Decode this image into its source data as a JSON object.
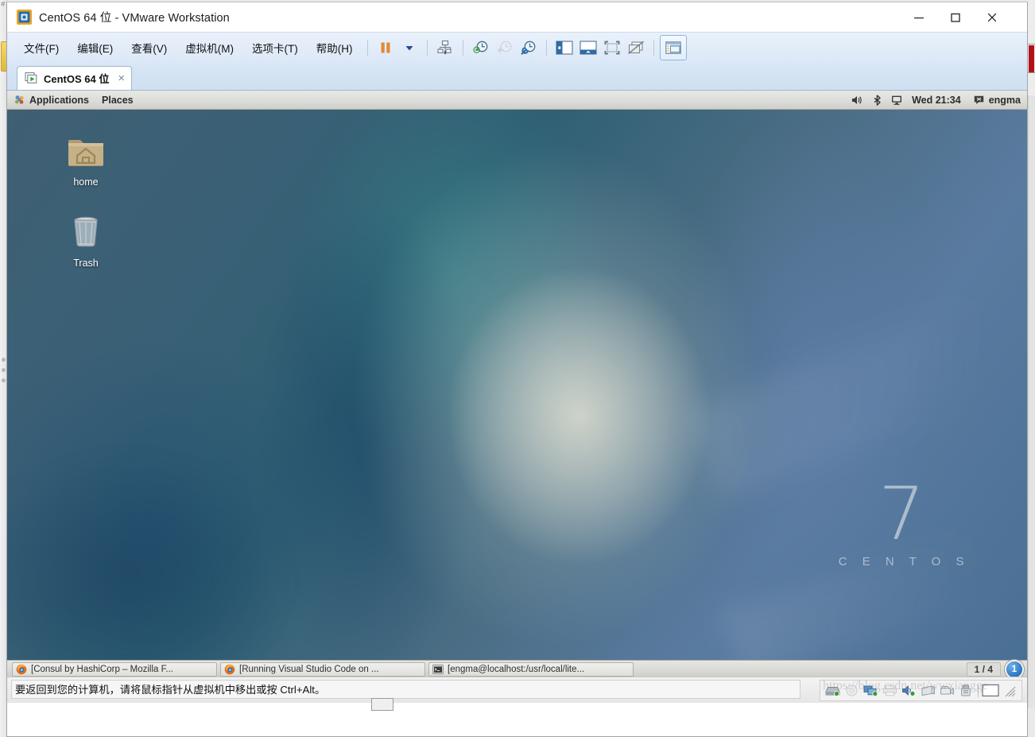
{
  "window": {
    "title": "CentOS 64 位 - VMware Workstation",
    "app_icon": "vmware-workstation-icon",
    "controls": {
      "minimize": "minimize-icon",
      "maximize": "maximize-icon",
      "close": "close-icon"
    }
  },
  "menubar": {
    "items": [
      {
        "label": "文件(F)",
        "name": "menu-file"
      },
      {
        "label": "编辑(E)",
        "name": "menu-edit"
      },
      {
        "label": "查看(V)",
        "name": "menu-view"
      },
      {
        "label": "虚拟机(M)",
        "name": "menu-vm"
      },
      {
        "label": "选项卡(T)",
        "name": "menu-tabs"
      },
      {
        "label": "帮助(H)",
        "name": "menu-help"
      }
    ]
  },
  "toolbar": {
    "buttons": [
      {
        "name": "suspend-button",
        "icon": "pause-icon",
        "enabled": true
      },
      {
        "name": "power-dropdown-button",
        "icon": "chevron-down-icon",
        "enabled": true
      },
      {
        "name": "manage-snapshots-button",
        "icon": "snapshot-manager-icon",
        "enabled": true
      },
      {
        "name": "take-snapshot-button",
        "icon": "clock-plus-icon",
        "enabled": true
      },
      {
        "name": "revert-snapshot-button",
        "icon": "clock-back-icon",
        "enabled": false
      },
      {
        "name": "snapshot-manager-button",
        "icon": "clock-wrench-icon",
        "enabled": true
      },
      {
        "name": "show-library-button",
        "icon": "sidebar-panel-icon",
        "enabled": true
      },
      {
        "name": "show-thumbnail-bar-button",
        "icon": "bottom-panel-icon",
        "enabled": true
      },
      {
        "name": "fullscreen-button",
        "icon": "fullscreen-icon",
        "enabled": true
      },
      {
        "name": "unity-mode-button",
        "icon": "unity-mode-icon",
        "enabled": true
      },
      {
        "name": "console-view-button",
        "icon": "console-view-icon",
        "enabled": true
      }
    ]
  },
  "tabs": [
    {
      "label": "CentOS 64 位",
      "icon": "vm-running-icon",
      "close": "×",
      "active": true
    }
  ],
  "guest": {
    "panel": {
      "apps_icon": "gnome-foot-icon",
      "applications_label": "Applications",
      "places_label": "Places",
      "volume_icon": "volume-icon",
      "bluetooth_icon": "bluetooth-icon",
      "display_icon": "display-icon",
      "clock": "Wed 21:34",
      "user_icon": "user-status-icon",
      "user": "engma"
    },
    "desktop": {
      "icons": [
        {
          "name": "desktop-icon-home",
          "label": "home",
          "glyph": "home-folder-icon"
        },
        {
          "name": "desktop-icon-trash",
          "label": "Trash",
          "glyph": "trash-icon"
        }
      ],
      "logo_number": "7",
      "logo_word": "C E N T O S"
    },
    "taskbar": {
      "windows": [
        {
          "name": "taskbar-item-firefox-consul",
          "icon": "firefox-icon",
          "label": "[Consul by HashiCorp – Mozilla F..."
        },
        {
          "name": "taskbar-item-firefox-vscode",
          "icon": "firefox-icon",
          "label": "[Running Visual Studio Code on ..."
        },
        {
          "name": "taskbar-item-terminal",
          "icon": "terminal-icon",
          "label": "[engma@localhost:/usr/local/lite..."
        }
      ],
      "workspace_count": "1 / 4",
      "workspace_current": "1"
    }
  },
  "statusbar": {
    "message": "要返回到您的计算机，请将鼠标指针从虚拟机中移出或按 Ctrl+Alt。",
    "watermark": "https://blog.csdn.net/wwxiangge",
    "devices": [
      {
        "name": "status-hard-disk-icon",
        "icon": "hard-disk-icon",
        "dim": false
      },
      {
        "name": "status-cd-dvd-icon",
        "icon": "cd-dvd-icon",
        "dim": true
      },
      {
        "name": "status-network-icon",
        "icon": "network-adapter-icon",
        "dim": false
      },
      {
        "name": "status-printer-icon",
        "icon": "printer-icon",
        "dim": true
      },
      {
        "name": "status-sound-icon",
        "icon": "sound-card-icon",
        "dim": false
      },
      {
        "name": "status-usb-controller-icon",
        "icon": "usb-controller-icon",
        "dim": false
      },
      {
        "name": "status-camera-icon",
        "icon": "camera-icon",
        "dim": false
      },
      {
        "name": "status-usb-device-icon",
        "icon": "usb-device-icon",
        "dim": false
      },
      {
        "name": "status-display-icon",
        "icon": "display-output-icon",
        "dim": false
      }
    ]
  },
  "colors": {
    "accent": "#2a74c0",
    "menubar_top": "#eaf1fb",
    "menubar_bottom": "#dce8f7",
    "tab_strip": "#d9e6f5",
    "panel_grey": "#dcdcd8",
    "desktop_blue": "#3f5f73",
    "status_red": "#b01217"
  }
}
